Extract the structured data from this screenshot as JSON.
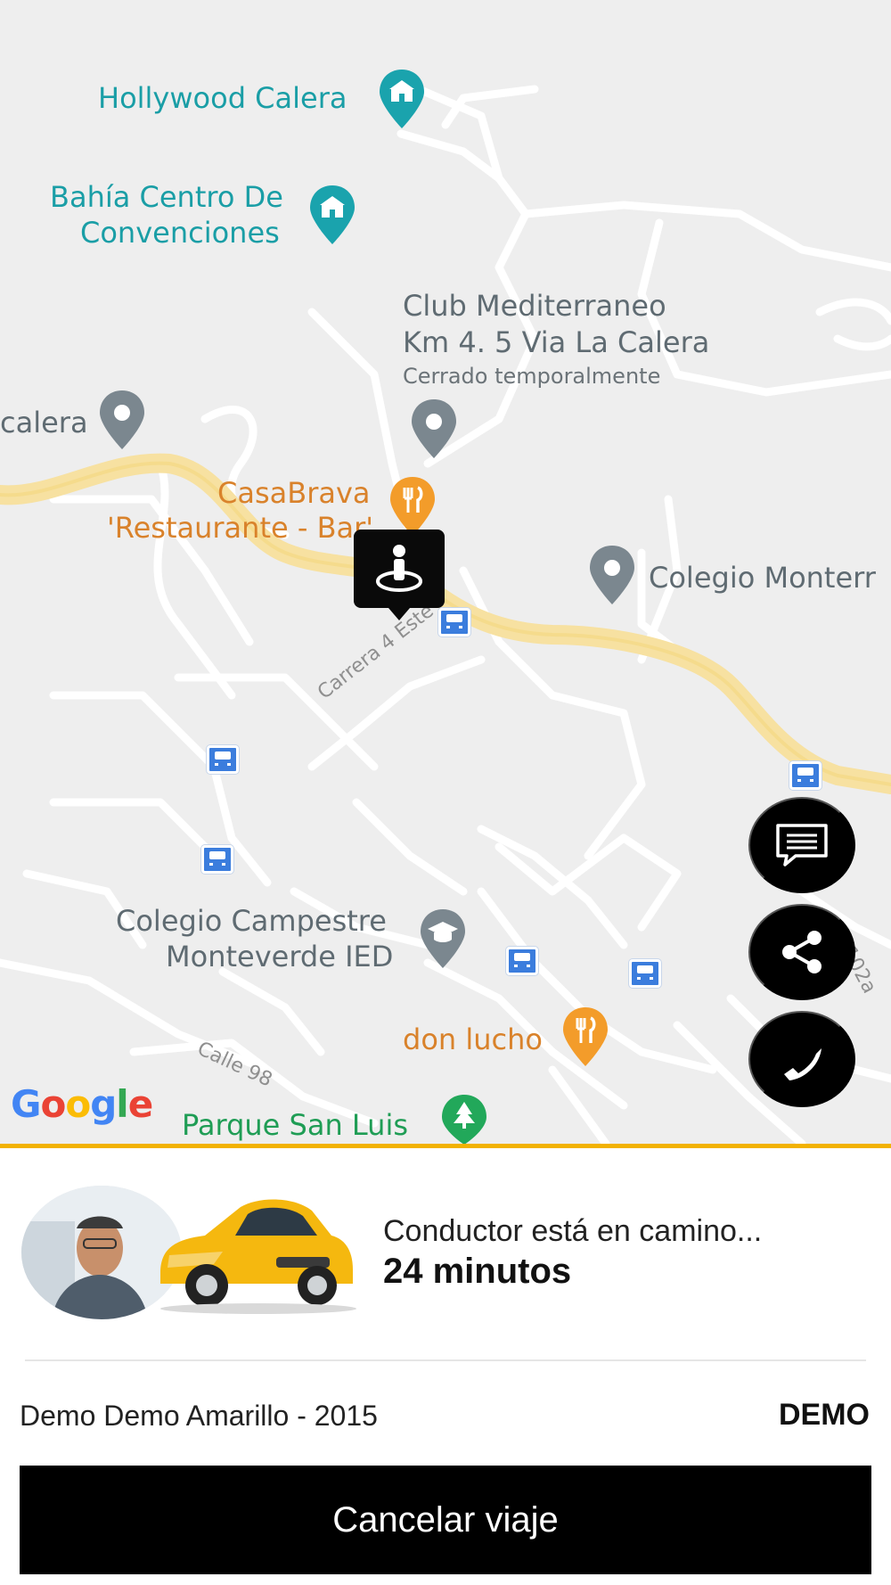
{
  "map": {
    "places": {
      "hollywood": "Hollywood Calera",
      "bahia_line1": "Bahía Centro De",
      "bahia_line2": "Convenciones",
      "club_line1": "Club Mediterraneo",
      "club_line2": "Km 4. 5 Via La Calera",
      "club_status": "Cerrado temporalmente",
      "calera": "calera",
      "casabrava_line1": "CasaBrava",
      "casabrava_line2": "'Restaurante - Bar'",
      "colegio_monterr": "Colegio Monterr",
      "colegio_campestre_line1": "Colegio Campestre",
      "colegio_campestre_line2": "Monteverde IED",
      "don_lucho": "don lucho",
      "parque": "Parque San Luis"
    },
    "streets": {
      "carrera": "Carrera 4 Este",
      "calle": "Calle 98",
      "edge": "102a"
    },
    "attribution": "Google",
    "icons": [
      "tourism-pin-icon",
      "place-pin-icon",
      "restaurant-pin-icon",
      "school-pin-icon",
      "park-pin-icon",
      "bus-stop-icon",
      "user-location-icon"
    ]
  },
  "actions": {
    "chat_icon": "chat-icon",
    "share_icon": "share-icon",
    "phone_icon": "phone-icon"
  },
  "trip": {
    "status": "Conductor está en camino...",
    "eta": "24 minutos",
    "vehicle": "Demo Demo Amarillo - 2015",
    "plate": "DEMO",
    "cancel_label": "Cancelar viaje"
  },
  "colors": {
    "accent": "#f2b200",
    "button_bg": "#000000",
    "map_bg": "#eeeeee",
    "main_road": "#f7e1a1"
  }
}
